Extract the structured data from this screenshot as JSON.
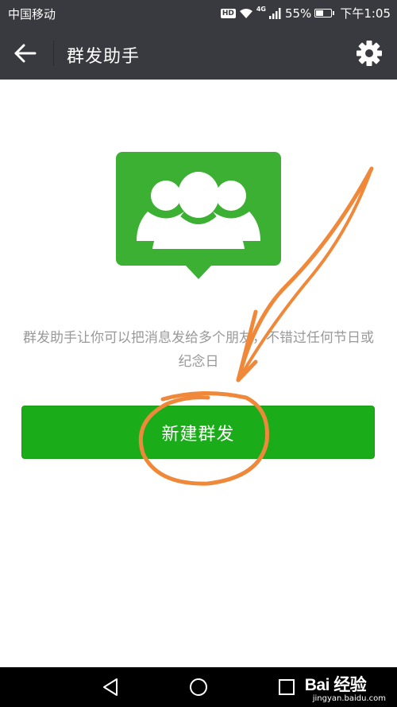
{
  "status_bar": {
    "carrier": "中国移动",
    "hd": "HD",
    "network": "4G",
    "battery_percent": "55%",
    "battery_level": 0.55,
    "time": "下午1:05"
  },
  "header": {
    "title": "群发助手",
    "back_icon": "arrow-left-icon",
    "settings_icon": "gear-icon"
  },
  "main": {
    "icon": "group-chat-icon",
    "description": "群发助手让你可以把消息发给多个朋友，不错过任何节日或纪念日",
    "button_label": "新建群发"
  },
  "nav_bar": {
    "back_icon": "triangle-back-icon",
    "home_icon": "circle-home-icon",
    "recents_icon": "square-recents-icon"
  },
  "watermark": {
    "logo": "Bai 经验",
    "url": "jingyan.baidu.com"
  },
  "colors": {
    "header_bg": "#393a3f",
    "accent_green": "#1aad19",
    "icon_green": "#3cb033",
    "annotation_orange": "#f0883a",
    "description_text": "#999999"
  }
}
